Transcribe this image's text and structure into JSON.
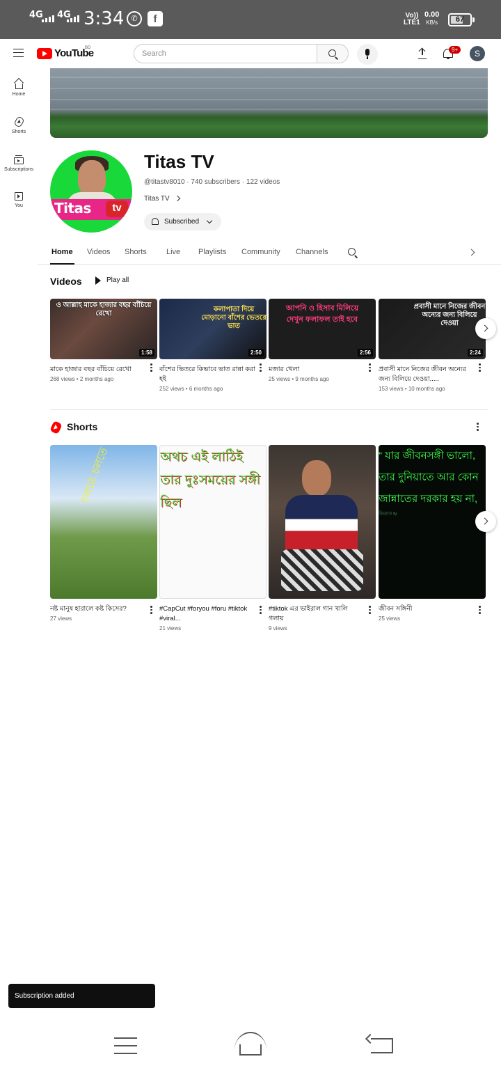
{
  "status_bar": {
    "net1": "4G",
    "net2": "4G",
    "time": "3:34",
    "volte_top": "Vo))",
    "volte_bottom": "LTE1",
    "speed": "0.00",
    "speed_unit": "KB/s",
    "battery": "67",
    "battery_level": 0.67
  },
  "header": {
    "logo_text": "YouTube",
    "country_code": "BD",
    "search_placeholder": "Search",
    "notification_count": "9+",
    "avatar_letter": "S"
  },
  "side_nav": {
    "items": [
      {
        "label": "Home",
        "icon": "home-icon"
      },
      {
        "label": "Shorts",
        "icon": "shorts-icon"
      },
      {
        "label": "Subscriptions",
        "icon": "subscriptions-icon"
      },
      {
        "label": "You",
        "icon": "library-icon"
      }
    ]
  },
  "channel": {
    "name": "Titas TV",
    "meta": "@titastv8010 · 740 subscribers · 122 videos",
    "link_label": "Titas TV",
    "subscribe_label": "Subscribed",
    "avatar_text_1": "Titas",
    "avatar_text_2": "tv"
  },
  "tabs": [
    {
      "label": "Home",
      "active": true
    },
    {
      "label": "Videos"
    },
    {
      "label": "Shorts"
    },
    {
      "label": "Live"
    },
    {
      "label": "Playlists"
    },
    {
      "label": "Community"
    },
    {
      "label": "Channels"
    }
  ],
  "videos_section": {
    "title": "Videos",
    "play_all": "Play all",
    "items": [
      {
        "thumb_text": "ও আল্লাহ মাকে হাজার বছর বাঁচিয়ে রেখো",
        "duration": "1:58",
        "title": "মাকে হাজার বছর বাঁচিয়ে রেখো",
        "meta": "268 views • 2 months ago"
      },
      {
        "thumb_text": "কলাপাতা দিয়ে মোড়ানো বাঁশের ভেতরে ভাত",
        "duration": "2:50",
        "title": "বাঁশের ভিতরে কিভাবে ভাত রান্না করা হই",
        "meta": "252 views • 6 months ago"
      },
      {
        "thumb_text": "আপনি ও হিসাব মিলিয়ে দেখুন ফলাফল তাই হবে",
        "duration": "2:56",
        "title": "মজার খেলা",
        "meta": "25 views • 9 months ago"
      },
      {
        "thumb_text": "প্রবাসী মানে নিজের জীবন অন্যের জন্য বিলিয়ে দেওয়া",
        "duration": "2:24",
        "title": "প্রবাসী মানে নিজের জীবন অন্যের জন্য বিলিয়ে দেওয়া.....",
        "meta": "153 views • 10 months ago"
      }
    ]
  },
  "shorts_section": {
    "title": "Shorts",
    "items": [
      {
        "thumb_text": "চলতে চলতে",
        "title": "নষ্ট মানুষ হারালে কষ্ট কিসের?",
        "meta": "27 views"
      },
      {
        "thumb_text": "অথচ এই লাঠিই তার দুঃসময়ের সঙ্গী ছিল",
        "title": "#CapCut #foryou #foru #tiktok #viral...",
        "meta": "21 views"
      },
      {
        "thumb_text": "",
        "title": "#tiktok এর ভাইরাল গান খালি গলায়",
        "meta": "9 views"
      },
      {
        "thumb_text": "“ যার জীবনসঙ্গী ভালো, তার দুনিয়াতে আর কোন জান্নাতের দরকার হয় না,",
        "watermark": "তিতাস tv",
        "title": "জীবন সঙ্গিনী",
        "meta": "25 views"
      }
    ]
  },
  "toast": {
    "text": "Subscription added"
  },
  "colors": {
    "accent": "#ff0000",
    "channel_avatar_bg": "#19d83a",
    "toast_bg": "#0f0f0f"
  }
}
